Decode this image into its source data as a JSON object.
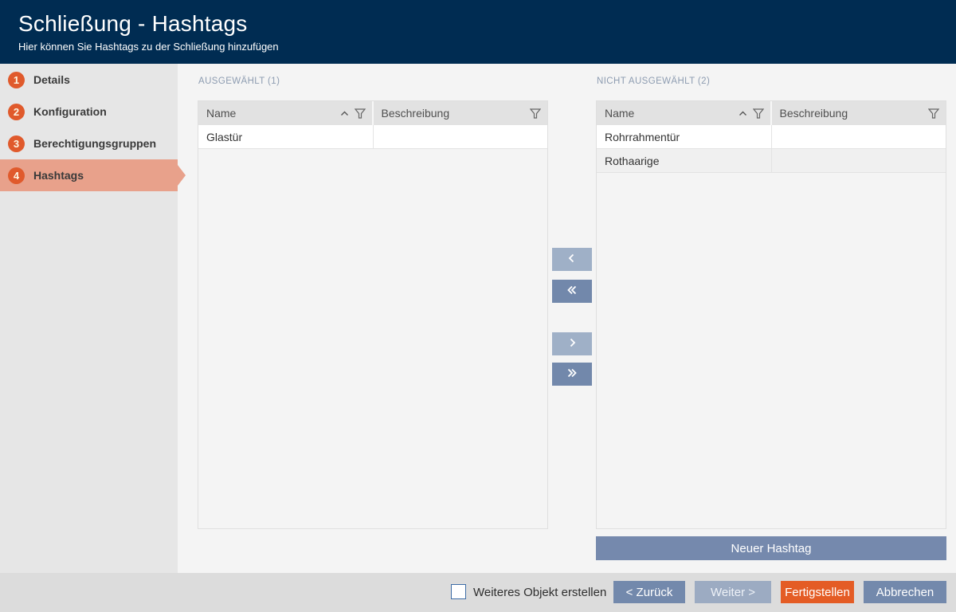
{
  "header": {
    "title": "Schließung - Hashtags",
    "subtitle": "Hier können Sie Hashtags zu der Schließung hinzufügen"
  },
  "sidebar": {
    "steps": [
      {
        "number": "1",
        "label": "Details",
        "active": false
      },
      {
        "number": "2",
        "label": "Konfiguration",
        "active": false
      },
      {
        "number": "3",
        "label": "Berechtigungsgruppen",
        "active": false
      },
      {
        "number": "4",
        "label": "Hashtags",
        "active": true
      }
    ]
  },
  "panels": {
    "selected": {
      "label": "AUSGEWÄHLT (1)",
      "columns": [
        "Name",
        "Beschreibung"
      ],
      "rows": [
        {
          "name": "Glastür",
          "beschreibung": ""
        }
      ]
    },
    "unselected": {
      "label": "NICHT AUSGEWÄHLT (2)",
      "columns": [
        "Name",
        "Beschreibung"
      ],
      "rows": [
        {
          "name": "Rohrrahmentür",
          "beschreibung": ""
        },
        {
          "name": "Rothaarige",
          "beschreibung": ""
        }
      ],
      "new_button": "Neuer Hashtag"
    }
  },
  "icons": {
    "sort_ascending": "chevron-up-icon",
    "filter": "funnel-icon",
    "move_left": "chevron-left-icon",
    "move_all_left": "double-chevron-left-icon",
    "move_right": "chevron-right-icon",
    "move_all_right": "double-chevron-right-icon"
  },
  "footer": {
    "checkbox_label": "Weiteres Objekt erstellen",
    "checkbox_checked": false,
    "back": "< Zurück",
    "next": "Weiter >",
    "finish": "Fertigstellen",
    "cancel": "Abbrechen"
  },
  "colors": {
    "header_bg": "#002c52",
    "accent_orange": "#e05a2c",
    "active_step_bg": "#e8a18b",
    "button_blue": "#7389ac",
    "button_blue_light": "#9fb0c7",
    "button_disabled": "#9cabc2",
    "finish_orange": "#e45c25",
    "sidebar_bg": "#e6e6e6",
    "footer_bg": "#dcdcdc",
    "table_header_bg": "#e2e2e2",
    "panel_label_color": "#8d9cb1"
  }
}
